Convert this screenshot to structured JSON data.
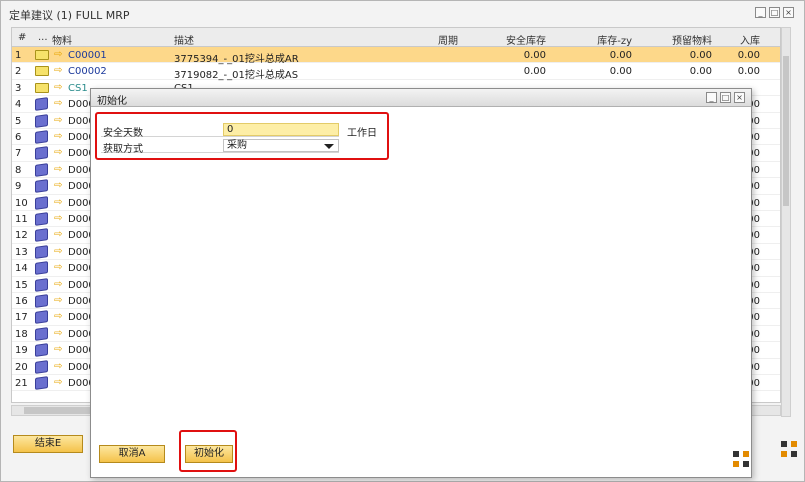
{
  "main": {
    "title": "定单建议 (1) FULL MRP",
    "window_buttons": [
      "_",
      "□",
      "×"
    ],
    "columns": [
      "#",
      "...",
      "物料",
      "描述",
      "周期",
      "安全库存",
      "库存-zy",
      "预留物料",
      "入库"
    ],
    "rows": [
      {
        "n": "1",
        "icon": "folder",
        "code": "C00001",
        "desc": "3775394_-_01挖斗总成AR",
        "safety": "0.00",
        "stock": "0.00",
        "reserved": "0.00",
        "inbound": "0.00"
      },
      {
        "n": "2",
        "icon": "folder",
        "code": "C00002",
        "desc": "3719082_-_01挖斗总成AS",
        "safety": "0.00",
        "stock": "0.00",
        "reserved": "0.00",
        "inbound": "0.00"
      },
      {
        "n": "3",
        "icon": "folder",
        "code": "CS1",
        "desc": "CS1",
        "safety": "",
        "stock": "",
        "reserved": "",
        "inbound": ""
      },
      {
        "n": "4",
        "icon": "cube",
        "code": "D000",
        "desc": "",
        "safety": "",
        "stock": "",
        "reserved": "",
        "inbound": ".00"
      },
      {
        "n": "5",
        "icon": "cube",
        "code": "D000",
        "desc": "",
        "safety": "",
        "stock": "",
        "reserved": "",
        "inbound": ".00"
      },
      {
        "n": "6",
        "icon": "cube",
        "code": "D000",
        "desc": "",
        "safety": "",
        "stock": "",
        "reserved": "",
        "inbound": ".00"
      },
      {
        "n": "7",
        "icon": "cube",
        "code": "D000",
        "desc": "",
        "safety": "",
        "stock": "",
        "reserved": "",
        "inbound": ".00"
      },
      {
        "n": "8",
        "icon": "cube",
        "code": "D000",
        "desc": "",
        "safety": "",
        "stock": "",
        "reserved": "",
        "inbound": ".00"
      },
      {
        "n": "9",
        "icon": "cube",
        "code": "D000",
        "desc": "",
        "safety": "",
        "stock": "",
        "reserved": "",
        "inbound": ".00"
      },
      {
        "n": "10",
        "icon": "cube",
        "code": "D000",
        "desc": "",
        "safety": "",
        "stock": "",
        "reserved": "",
        "inbound": ".00"
      },
      {
        "n": "11",
        "icon": "cube",
        "code": "D000",
        "desc": "",
        "safety": "",
        "stock": "",
        "reserved": "",
        "inbound": ".00"
      },
      {
        "n": "12",
        "icon": "cube",
        "code": "D000",
        "desc": "",
        "safety": "",
        "stock": "",
        "reserved": "",
        "inbound": ".00"
      },
      {
        "n": "13",
        "icon": "cube",
        "code": "D000",
        "desc": "",
        "safety": "",
        "stock": "",
        "reserved": "",
        "inbound": ".00"
      },
      {
        "n": "14",
        "icon": "cube",
        "code": "D000",
        "desc": "",
        "safety": "",
        "stock": "",
        "reserved": "",
        "inbound": ".00"
      },
      {
        "n": "15",
        "icon": "cube",
        "code": "D000",
        "desc": "",
        "safety": "",
        "stock": "",
        "reserved": "",
        "inbound": ".00"
      },
      {
        "n": "16",
        "icon": "cube",
        "code": "D000",
        "desc": "",
        "safety": "",
        "stock": "",
        "reserved": "",
        "inbound": ".00"
      },
      {
        "n": "17",
        "icon": "cube",
        "code": "D000",
        "desc": "",
        "safety": "",
        "stock": "",
        "reserved": "",
        "inbound": ".00"
      },
      {
        "n": "18",
        "icon": "cube",
        "code": "D000",
        "desc": "",
        "safety": "",
        "stock": "",
        "reserved": "",
        "inbound": ".00"
      },
      {
        "n": "19",
        "icon": "cube",
        "code": "D000",
        "desc": "",
        "safety": "",
        "stock": "",
        "reserved": "",
        "inbound": ".00"
      },
      {
        "n": "20",
        "icon": "cube",
        "code": "D000",
        "desc": "",
        "safety": "",
        "stock": "",
        "reserved": "",
        "inbound": ".00"
      },
      {
        "n": "21",
        "icon": "cube",
        "code": "D000",
        "desc": "",
        "safety": "",
        "stock": "",
        "reserved": "",
        "inbound": ".00"
      }
    ],
    "end_button": "结束E"
  },
  "dialog": {
    "title": "初始化",
    "fields": [
      {
        "label": "安全天数",
        "value": "0"
      },
      {
        "label": "获取方式",
        "value": "采购"
      }
    ],
    "unit": "工作日",
    "cancel_button": "取消A",
    "init_button": "初始化"
  },
  "colors": {
    "selected_row": "#fdd88a",
    "button_gold": "#f4c24a",
    "highlight_red": "#e01010",
    "code_blue": "#1c3a9c"
  }
}
